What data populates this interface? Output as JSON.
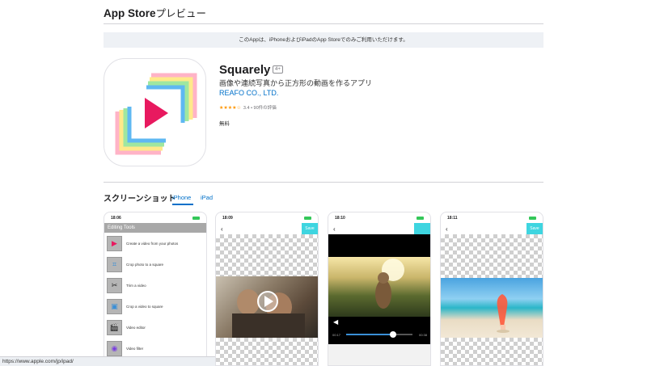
{
  "header": {
    "brand": "App Store",
    "suffix": "プレビュー"
  },
  "notice": "このAppは、iPhoneおよびiPadのApp Storeでのみご利用いただけます。",
  "app": {
    "name": "Squarely",
    "age": "4+",
    "subtitle": "画像や連続写真から正方形の動画を作るアプリ",
    "developer": "REAFO CO., LTD.",
    "stars": "★★★★☆",
    "rating_text": "3.4 • 90件の評価",
    "price": "無料"
  },
  "screenshots_section": {
    "title": "スクリーンショット",
    "tabs": [
      "iPhone",
      "iPad"
    ]
  },
  "screens": [
    {
      "time": "18:06",
      "toolbar": "Editing Tools",
      "tools": [
        {
          "label": "Create a video from your photos",
          "icon": "play-icon"
        },
        {
          "label": "Crop photo to a square",
          "icon": "crop-icon"
        },
        {
          "label": "Trim a video",
          "icon": "trim-icon"
        },
        {
          "label": "Crop a video to square",
          "icon": "crop-video-icon"
        },
        {
          "label": "Video editor",
          "icon": "clapper-icon"
        },
        {
          "label": "Video filter",
          "icon": "filter-icon"
        }
      ]
    },
    {
      "time": "18:09",
      "back": "‹",
      "save": "Save"
    },
    {
      "time": "18:10",
      "back": "‹",
      "time_start": "00:17",
      "time_end": "00:38"
    },
    {
      "time": "18:11",
      "back": "‹",
      "save": "Save"
    }
  ],
  "statusbar_url": "https://www.apple.com/jp/ipad/"
}
